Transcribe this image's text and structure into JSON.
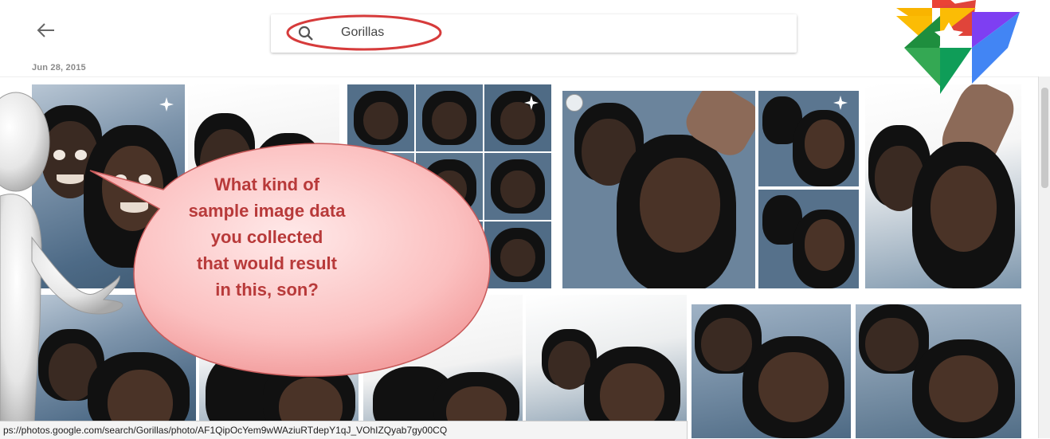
{
  "search": {
    "value": "Gorillas",
    "icon": "search-icon"
  },
  "nav": {
    "back_icon": "arrow-left-icon"
  },
  "date_label": "Jun 28, 2015",
  "status_url": "ps://photos.google.com/search/Gorillas/photo/AF1QipOcYem9wWAziuRTdepY1qJ_VOhIZQyab7gy00CQ",
  "callout": {
    "lines": [
      "What kind of",
      "sample image data",
      "you collected",
      "that would result",
      "in this, son?"
    ]
  },
  "colors": {
    "callout_text": "#b83a3a",
    "callout_fill": "#f9b7b7",
    "highlight_circle": "#d63b3b"
  }
}
